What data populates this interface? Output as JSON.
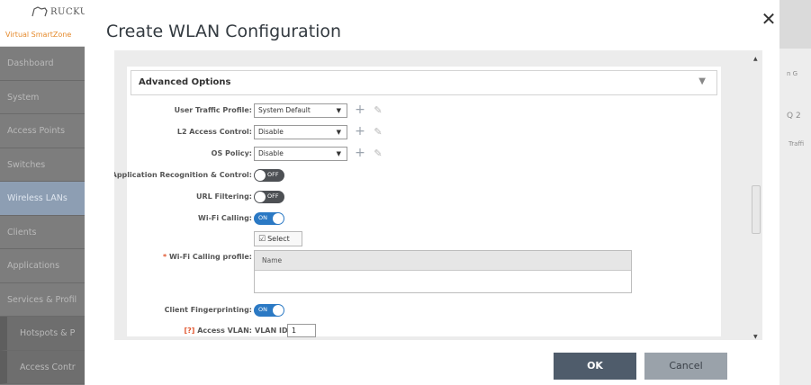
{
  "brand": {
    "logo_text": "RUCKU",
    "product": "Virtual SmartZone"
  },
  "sidebar": {
    "items": [
      {
        "label": "Dashboard"
      },
      {
        "label": "System"
      },
      {
        "label": "Access Points"
      },
      {
        "label": "Switches"
      },
      {
        "label": "Wireless LANs"
      },
      {
        "label": "Clients"
      },
      {
        "label": "Applications"
      },
      {
        "label": "Services & Profil"
      },
      {
        "label": "Hotspots & P"
      },
      {
        "label": "Access Contr"
      }
    ]
  },
  "right_bg": {
    "text_a": "n G",
    "text_b": "Traffi",
    "text_c": "Q 2"
  },
  "modal": {
    "title": "Create WLAN Configuration",
    "close_glyph": "✕",
    "section": {
      "title": "Advanced Options",
      "caret": "▼"
    },
    "fields": {
      "user_traffic_profile": {
        "label": "User Traffic Profile:",
        "value": "System Default"
      },
      "l2_access_control": {
        "label": "L2 Access Control:",
        "value": "Disable"
      },
      "os_policy": {
        "label": "OS Policy:",
        "value": "Disable"
      },
      "app_recognition": {
        "label": "Application Recognition & Control:",
        "state": "OFF"
      },
      "url_filtering": {
        "label": "URL Filtering:",
        "state": "OFF"
      },
      "wifi_calling": {
        "label": "Wi-Fi Calling:",
        "state": "ON"
      },
      "select_button": {
        "label": "Select"
      },
      "wifi_calling_profile": {
        "required_mark": "*",
        "label": "Wi-Fi Calling profile:",
        "column_header": "Name"
      },
      "client_fingerprinting": {
        "label": "Client Fingerprinting:",
        "state": "ON"
      },
      "access_vlan": {
        "marker": "[?]",
        "label": "Access VLAN:",
        "prefix": "VLAN ID",
        "value": "1"
      }
    },
    "select_caret": "▼",
    "add_glyph": "+",
    "edit_glyph": "✎"
  },
  "footer": {
    "ok_label": "OK",
    "cancel_label": "Cancel"
  }
}
